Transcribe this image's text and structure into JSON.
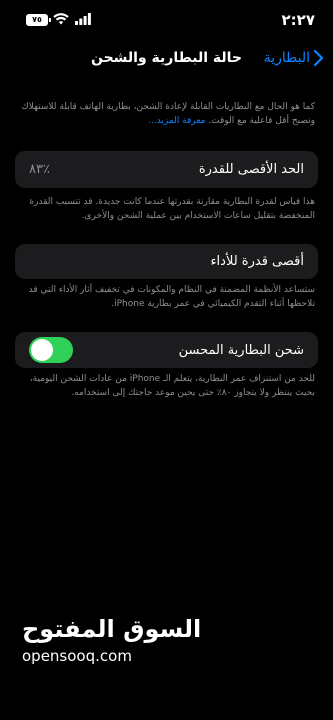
{
  "status_bar": {
    "time": "٢:٢٧",
    "battery_level": "٧٥"
  },
  "nav": {
    "back_label": "البطارية",
    "title": "حالة البطارية والشحن"
  },
  "intro": {
    "text": "كما هو الحال مع البطاريات القابلة لإعادة الشحن، بطارية الهاتف قابلة للاستهلاك وتصبح أقل فاعلية مع الوقت.",
    "link": "معرفة المزيد..."
  },
  "max_capacity": {
    "label": "الحد الأقصى للقدرة",
    "value": "٪٨٣",
    "description": "هذا قياس لقدرة البطارية مقارنة بقدرتها عندما كانت جديدة. قد تتسبب القدرة المنخفضة بتقليل ساعات الاستخدام بين عملية الشحن والأخرى."
  },
  "peak_performance": {
    "label": "أقصى قدرة للأداء",
    "description": "ستساعد الأنظمة المضمنة في النظام والمكونات في تخفيف آثار الأداء التي قد تلاحظها أثناء التقدم الكيميائي في عمر بطارية iPhone."
  },
  "optimized_charging": {
    "label": "شحن البطارية المحسن",
    "enabled": true,
    "description": "للحد من استنزاف عمر البطارية، يتعلم الـ iPhone من عادات الشحن اليومية، بحيث ينتظر ولا يتجاوز ٨٠٪ حتى يحين موعد حاجتك إلى استخدامه."
  },
  "watermark": {
    "arabic": "السوق المفتوح",
    "latin": "opensooq.com"
  },
  "colors": {
    "accent": "#0a84ff",
    "toggle_on": "#30d158",
    "card_bg": "#1c1c1e",
    "secondary_text": "#8e8e93"
  }
}
